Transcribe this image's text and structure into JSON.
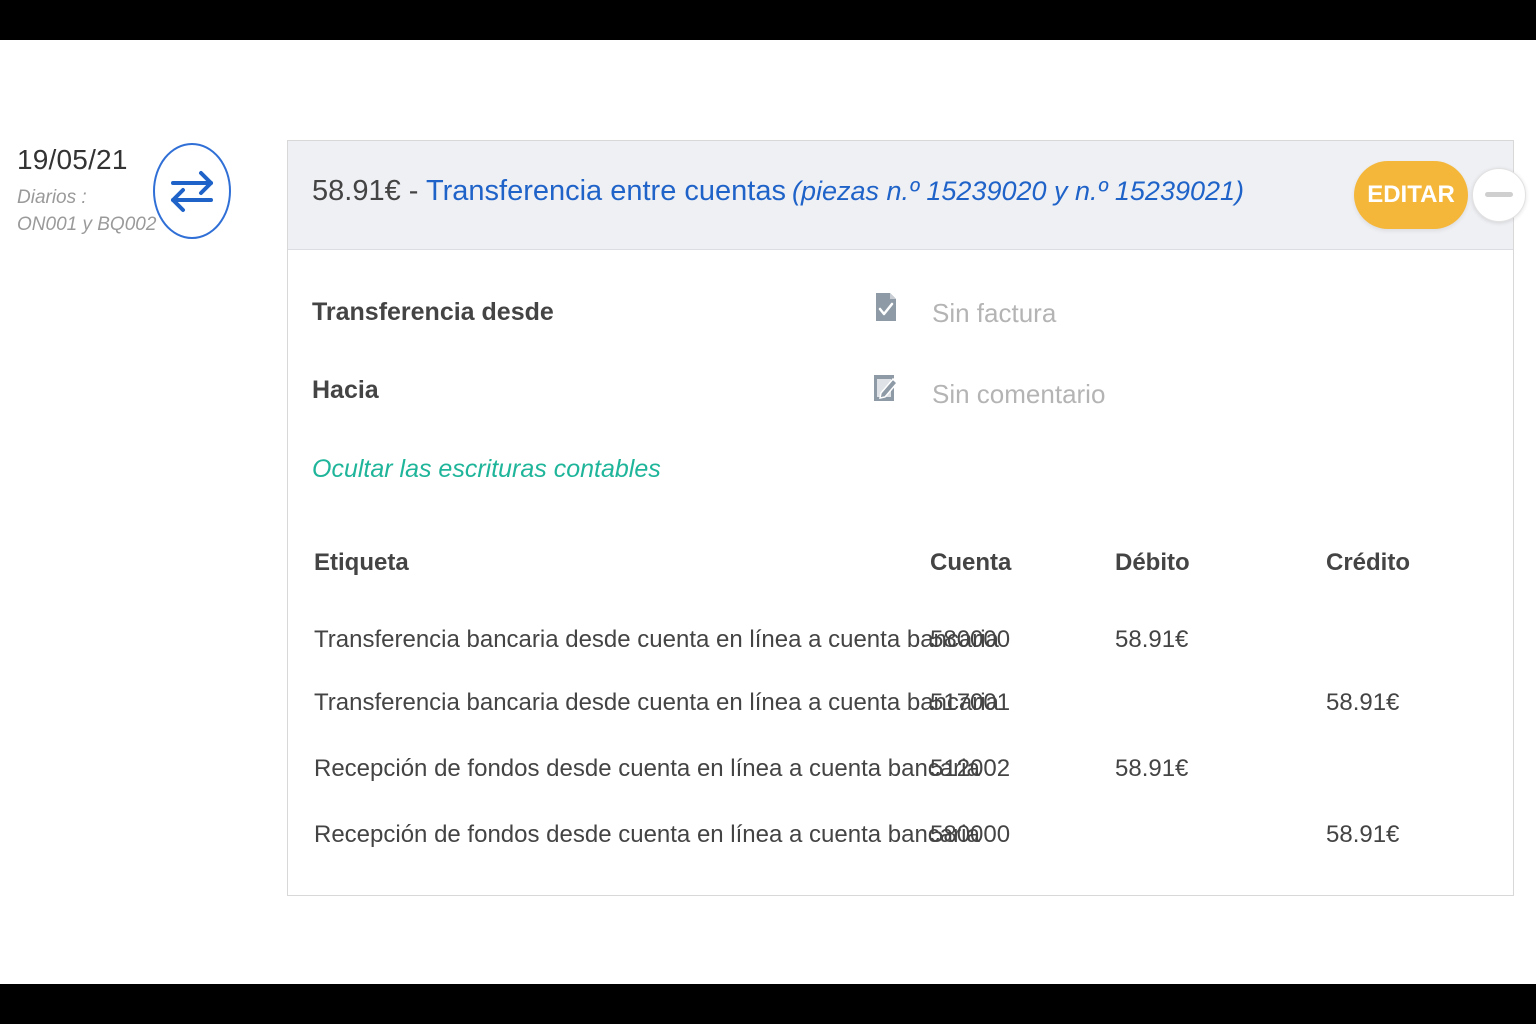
{
  "entry": {
    "date": "19/05/21",
    "journals_label": "Diarios :",
    "journals_value": "ON001 y BQ002",
    "type_icon": "transfer-arrows-icon"
  },
  "header": {
    "amount": "58.91€",
    "separator": " - ",
    "title": "Transferencia entre cuentas",
    "pieces": "(piezas n.º 15239020 y n.º 15239021)",
    "edit_label": "EDITAR"
  },
  "details": {
    "from_label": "Transferencia desde",
    "to_label": "Hacia",
    "invoice_text": "Sin factura",
    "comment_text": "Sin comentario",
    "toggle_entries": "Ocultar las escrituras contables"
  },
  "table": {
    "headers": {
      "label": "Etiqueta",
      "account": "Cuenta",
      "debit": "Débito",
      "credit": "Crédito"
    },
    "rows": [
      {
        "label": "Transferencia bancaria desde cuenta en línea a cuenta bancaria",
        "account": "580000",
        "debit": "58.91€",
        "credit": ""
      },
      {
        "label": "Transferencia bancaria desde cuenta en línea a cuenta bancaria",
        "account": "517001",
        "debit": "",
        "credit": "58.91€"
      },
      {
        "label": "Recepción de fondos desde cuenta en línea a cuenta bancaria",
        "account": "512002",
        "debit": "58.91€",
        "credit": ""
      },
      {
        "label": "Recepción de fondos desde cuenta en línea a cuenta bancaria",
        "account": "580000",
        "debit": "",
        "credit": "58.91€"
      }
    ]
  },
  "colors": {
    "accent_blue": "#1f63c9",
    "edit_yellow": "#f4b73a",
    "link_teal": "#1fb59a"
  }
}
